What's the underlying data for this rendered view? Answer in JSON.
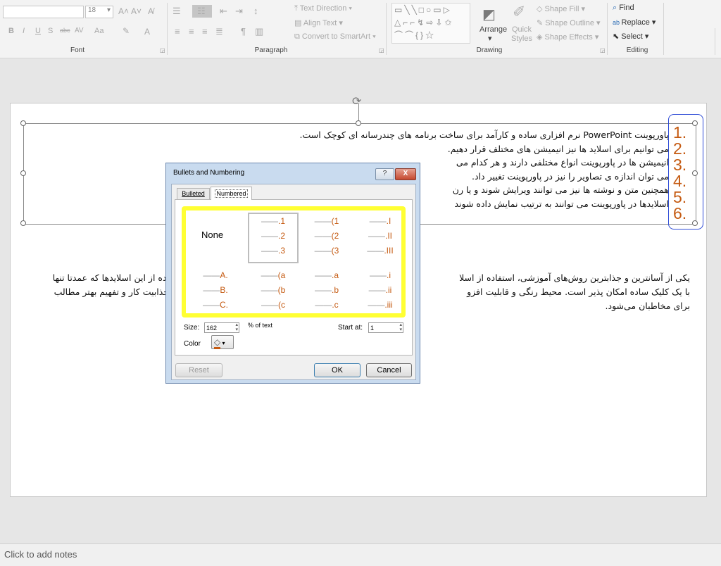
{
  "ribbon": {
    "font": {
      "font_name": "",
      "font_size": "18",
      "label": "Font",
      "row2": [
        "B",
        "I",
        "U",
        "S",
        "abc",
        "AV",
        "Aa",
        "A"
      ]
    },
    "paragraph": {
      "label": "Paragraph",
      "text_direction": "Text Direction",
      "align_text": "Align Text",
      "convert_smartart": "Convert to SmartArt"
    },
    "drawing": {
      "label": "Drawing",
      "arrange": "Arrange",
      "quick_styles": "Quick Styles",
      "shape_fill": "Shape Fill",
      "shape_outline": "Shape Outline",
      "shape_effects": "Shape Effects"
    },
    "editing": {
      "label": "Editing",
      "find": "Find",
      "replace": "Replace",
      "select": "Select"
    }
  },
  "slide": {
    "list_lines": [
      "پاورپوینت PowerPoint نرم افزاری ساده و کارآمد برای ساخت برنامه های چندرسانه ای کوچک است.",
      "می توانیم برای اسلاید ها نیز انیمیشن های مختلف قرار دهیم.",
      "انیمیشن ها در پاورپوینت انواع مختلفی دارند و هر کدام می",
      "می توان اندازه ی تصاویر را نیز در پاورپوینت تغییر داد.",
      "همچنین متن و نوشته ها نیز می توانند ویرایش شوند و یا رن",
      "اسلایدها در پاورپوینت می توانند به ترتیب نمایش داده شوند"
    ],
    "list_numbers": [
      "1.",
      "2.",
      "3.",
      "4.",
      "5.",
      "6."
    ],
    "para_left_lines": [
      "یکی از آسانترین و جذابترین روش‌های آموزشی، استفاده از اسلا",
      "با یک کلیک ساده امکان پذیر است. محیط رنگی و قابلیت افزو",
      "برای مخاطبان می‌شود."
    ],
    "para_right_lines": [
      "اده از این اسلایدها که عمدتا تنها",
      "جذابیت کار و تفهیم بهتر مطالب"
    ]
  },
  "notes_placeholder": "Click to add notes",
  "dialog": {
    "title": "Bullets and Numbering",
    "tabs": [
      "Bulleted",
      "Numbered"
    ],
    "none_label": "None",
    "grid": [
      [
        [
          "",
          "",
          ""
        ],
        [
          ".1",
          ".2",
          ".3"
        ],
        [
          "(1",
          "(2",
          "(3"
        ],
        [
          ".I",
          ".II",
          ".III"
        ]
      ],
      [
        [
          "A.",
          "B.",
          "C."
        ],
        [
          "(a",
          "(b",
          "(c"
        ],
        [
          ".a",
          ".b",
          ".c"
        ],
        [
          ".i",
          ".ii",
          ".iii"
        ]
      ]
    ],
    "size_label": "Size:",
    "size_value": "162",
    "size_unit": "% of text",
    "start_label": "Start at:",
    "start_value": "1",
    "color_label": "Color",
    "reset": "Reset",
    "ok": "OK",
    "cancel": "Cancel",
    "help": "?",
    "close": "X"
  },
  "colors": {
    "highlight": "#ffff33",
    "numbers": "#c55a11",
    "annotation": "#2d4bd6"
  }
}
